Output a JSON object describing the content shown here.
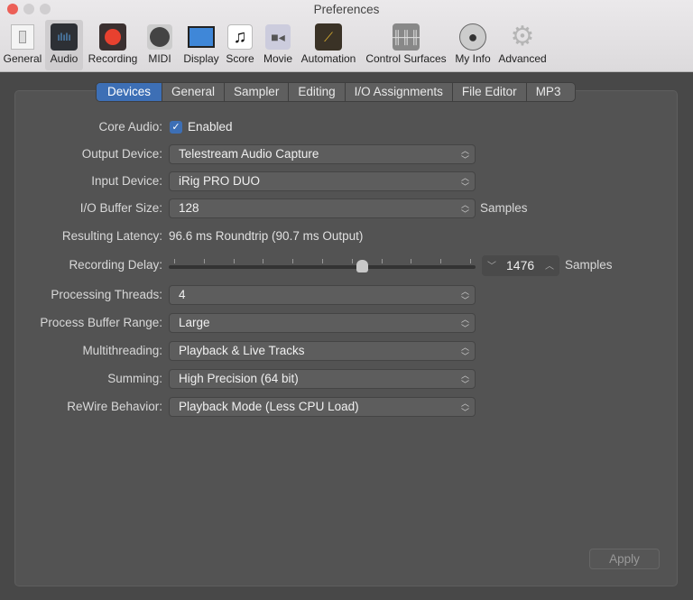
{
  "window": {
    "title": "Preferences"
  },
  "toolbar": [
    {
      "label": "General",
      "icon": "switch-icon"
    },
    {
      "label": "Audio",
      "icon": "waveform-icon",
      "selected": true
    },
    {
      "label": "Recording",
      "icon": "record-icon"
    },
    {
      "label": "MIDI",
      "icon": "midi-port-icon"
    },
    {
      "label": "Display",
      "icon": "monitor-icon"
    },
    {
      "label": "Score",
      "icon": "music-note-icon"
    },
    {
      "label": "Movie",
      "icon": "video-camera-icon"
    },
    {
      "label": "Automation",
      "icon": "automation-icon"
    },
    {
      "label": "Control Surfaces",
      "icon": "faders-icon"
    },
    {
      "label": "My Info",
      "icon": "user-icon"
    },
    {
      "label": "Advanced",
      "icon": "gear-icon"
    }
  ],
  "tabs": [
    "Devices",
    "General",
    "Sampler",
    "Editing",
    "I/O Assignments",
    "File Editor",
    "MP3"
  ],
  "active_tab": "Devices",
  "form": {
    "core_audio": {
      "label": "Core Audio:",
      "checkbox": "Enabled",
      "checked": true
    },
    "output_device": {
      "label": "Output Device:",
      "value": "Telestream Audio Capture"
    },
    "input_device": {
      "label": "Input Device:",
      "value": "iRig PRO DUO"
    },
    "buffer_size": {
      "label": "I/O Buffer Size:",
      "value": "128",
      "unit": "Samples"
    },
    "latency": {
      "label": "Resulting Latency:",
      "value": "96.6 ms Roundtrip (90.7 ms Output)"
    },
    "recording_delay": {
      "label": "Recording Delay:",
      "slider_fraction": 0.63,
      "value": "1476",
      "unit": "Samples"
    },
    "processing_threads": {
      "label": "Processing Threads:",
      "value": "4"
    },
    "process_buffer_range": {
      "label": "Process Buffer Range:",
      "value": "Large"
    },
    "multithreading": {
      "label": "Multithreading:",
      "value": "Playback & Live Tracks"
    },
    "summing": {
      "label": "Summing:",
      "value": "High Precision (64 bit)"
    },
    "rewire": {
      "label": "ReWire Behavior:",
      "value": "Playback Mode (Less CPU Load)"
    }
  },
  "apply_label": "Apply"
}
